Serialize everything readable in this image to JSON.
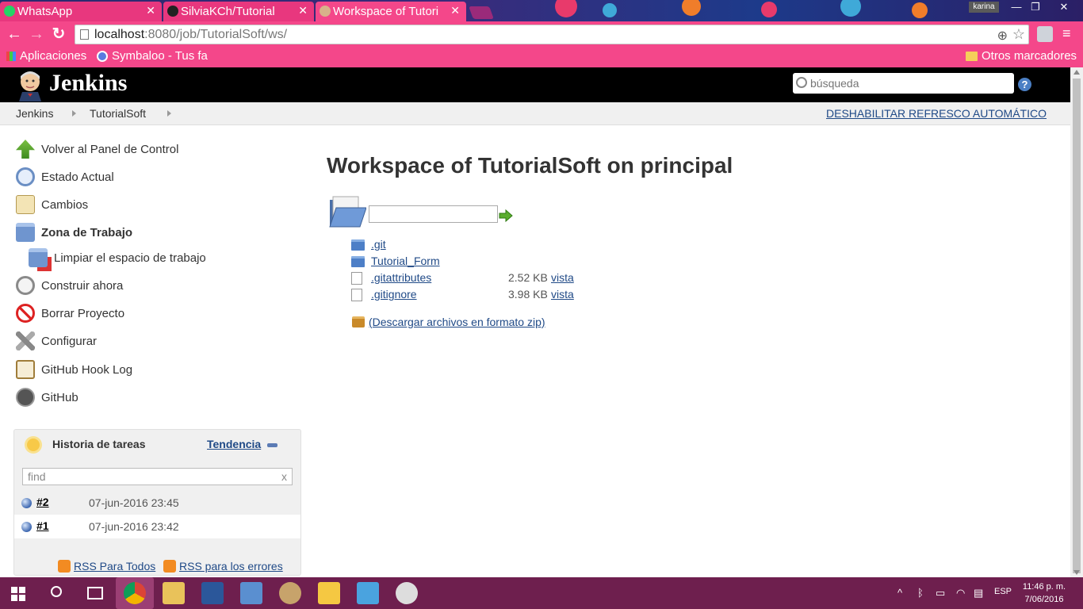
{
  "browser": {
    "tabs": [
      {
        "label": "WhatsApp",
        "icon": "whatsapp-icon"
      },
      {
        "label": "SilviaKCh/Tutorial",
        "icon": "github-icon"
      },
      {
        "label": "Workspace of Tutori",
        "icon": "jenkins-icon"
      }
    ],
    "profile_name": "karina",
    "url_host": "localhost",
    "url_path": ":8080/job/TutorialSoft/ws/",
    "bookmarks": [
      {
        "label": "Aplicaciones",
        "icon": "apps-grid-icon"
      },
      {
        "label": "Symbaloo - Tus fa",
        "icon": "symbaloo-icon"
      }
    ],
    "other_bookmarks": "Otros marcadores",
    "accent_color": "#f4478a"
  },
  "jenkins": {
    "title": "Jenkins",
    "search_placeholder": "búsqueda",
    "help_label": "?",
    "breadcrumb": [
      "Jenkins",
      "TutorialSoft"
    ],
    "autorefresh": "DESHABILITAR REFRESCO AUTOMÁTICO"
  },
  "sidebar": {
    "tasks": [
      {
        "label": "Volver al Panel de Control",
        "icon": "up-arrow-icon"
      },
      {
        "label": "Estado Actual",
        "icon": "magnifier-icon"
      },
      {
        "label": "Cambios",
        "icon": "notepad-icon"
      },
      {
        "label": "Zona de Trabajo",
        "icon": "folder-icon"
      },
      {
        "label": "Limpiar el espacio de trabajo",
        "icon": "folder-delete-icon"
      },
      {
        "label": "Construir ahora",
        "icon": "clock-icon"
      },
      {
        "label": "Borrar Proyecto",
        "icon": "no-entry-icon"
      },
      {
        "label": "Configurar",
        "icon": "tools-icon"
      },
      {
        "label": "GitHub Hook Log",
        "icon": "clipboard-icon"
      },
      {
        "label": "GitHub",
        "icon": "github-icon"
      }
    ]
  },
  "history": {
    "title": "Historia de tareas",
    "trend": "Tendencia",
    "find_placeholder": "find",
    "find_clear": "x",
    "builds": [
      {
        "number": "#2",
        "date": "07-jun-2016 23:45"
      },
      {
        "number": "#1",
        "date": "07-jun-2016 23:42"
      }
    ],
    "rss_all": "RSS Para Todos",
    "rss_failures": "RSS para los errores"
  },
  "main": {
    "title": "Workspace of TutorialSoft on principal",
    "files": [
      {
        "name": ".git",
        "type": "dir",
        "size": "",
        "view": ""
      },
      {
        "name": "Tutorial_Form",
        "type": "dir",
        "size": "",
        "view": ""
      },
      {
        "name": ".gitattributes",
        "type": "file",
        "size": "2.52 KB",
        "view": "vista"
      },
      {
        "name": ".gitignore",
        "type": "file",
        "size": "3.98 KB",
        "view": "vista"
      }
    ],
    "zip_link": "(Descargar archivos en formato zip)"
  },
  "taskbar": {
    "time": "11:46 p. m.",
    "date": "7/06/2016",
    "lang": "ESP"
  }
}
